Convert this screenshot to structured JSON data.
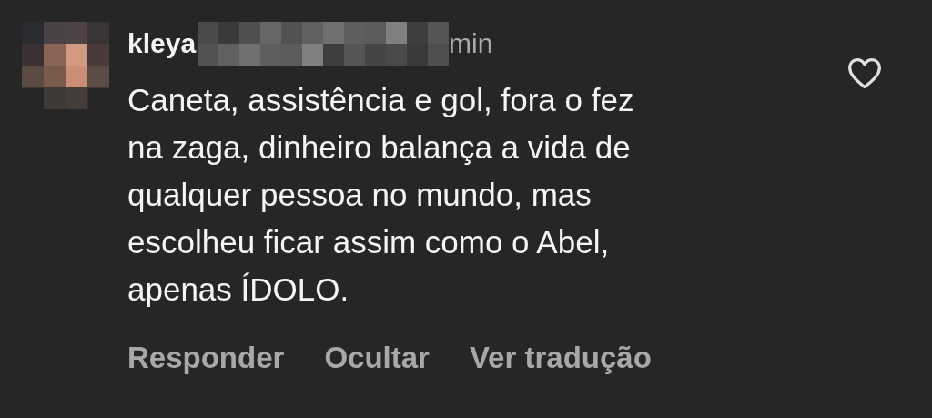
{
  "comment": {
    "username": "kleya",
    "time": "min",
    "text": "Caneta, assistência e gol, fora o fez\nna zaga, dinheiro balança a vida de\nqualquer pessoa no mundo, mas\nescolheu ficar assim como o Abel,\napenas ÍDOLO.",
    "liked": false,
    "actions": [
      "Responder",
      "Ocultar",
      "Ver tradução"
    ]
  }
}
